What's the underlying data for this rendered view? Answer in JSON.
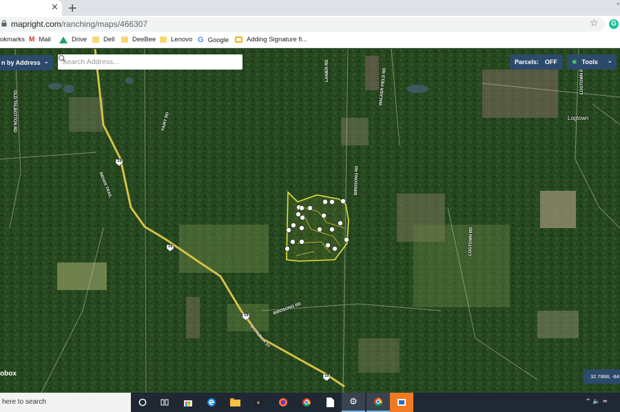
{
  "browser": {
    "tab_close": "×",
    "new_tab": "+",
    "tab_menu": "˅",
    "url_host": "mapright.com",
    "url_path": "/ranching/maps/466307",
    "star_icon": "☆",
    "extension_letter": "G"
  },
  "bookmarks": [
    {
      "label": "okmarks",
      "icon": "none"
    },
    {
      "label": "Mail",
      "icon": "gmail-icon"
    },
    {
      "label": "Drive",
      "icon": "drive-icon"
    },
    {
      "label": "Dell",
      "icon": "folder-icon"
    },
    {
      "label": "DeeBee",
      "icon": "folder-icon"
    },
    {
      "label": "Lenovo",
      "icon": "folder-icon"
    },
    {
      "label": "Google",
      "icon": "google-icon"
    },
    {
      "label": "Adding Signature fi...",
      "icon": "signature-icon"
    }
  ],
  "map_ui": {
    "address_button": "n by Address",
    "search_placeholder": "Search Address...",
    "parcels_label": "Parcels:",
    "parcels_state": "OFF",
    "tools_label": "Tools",
    "attribution": "obox",
    "coords": "32.7888, -84"
  },
  "map_labels": {
    "old_talbotton": "OLD TALBOTTON RD",
    "lanier": "LANIER RD",
    "walker": "WALKER FIELD RD",
    "logtown_n": "LOGTOWN RD",
    "logtown_place": "Logtown",
    "fairy": "FAIRY RD",
    "indian": "INDIAN TRAIL",
    "birdsong_n": "BIRDSONG RD",
    "logtown_s": "LOGTOWN RD",
    "birdsong_s": "BIRDSONG RD",
    "church": "N CHURCH ST",
    "hwy": "19"
  },
  "taskbar": {
    "search_text": "here to search",
    "tray_text": "^ 🔈 ≈"
  },
  "colors": {
    "boundary": "#e5e140",
    "highway": "#d7c24a",
    "ui_blue": "#2c4a6b"
  }
}
